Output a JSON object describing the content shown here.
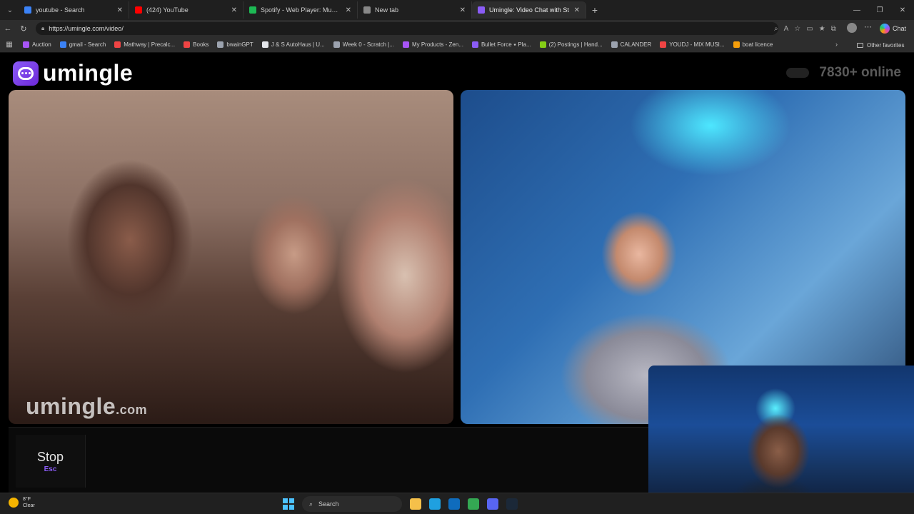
{
  "browser": {
    "tabs": [
      {
        "title": "youtube - Search",
        "favicon_color": "#3b82f6",
        "active": false,
        "width": 155
      },
      {
        "title": "(424) YouTube",
        "favicon_color": "#ff0000",
        "active": false,
        "width": 160
      },
      {
        "title": "Spotify - Web Player: Music for ev",
        "favicon_color": "#1db954",
        "active": false,
        "width": 160
      },
      {
        "title": "New tab",
        "favicon_color": "#888888",
        "active": false,
        "width": 160
      },
      {
        "title": "Umingle: Video Chat with St",
        "favicon_color": "#8b5cf6",
        "active": true,
        "width": 160
      }
    ],
    "new_tab_label": "+",
    "url": "https://umingle.com/video/",
    "copilot_label": "Chat",
    "bookmarks": [
      {
        "label": "Auction",
        "color": "#a855f7"
      },
      {
        "label": "gmail - Search",
        "color": "#3b82f6"
      },
      {
        "label": "Mathway | Precalc...",
        "color": "#ef4444"
      },
      {
        "label": "Books",
        "color": "#ef4444"
      },
      {
        "label": "bwainGPT",
        "color": "#9ca3af"
      },
      {
        "label": "J & S AutoHaus | U...",
        "color": "#e5e7eb"
      },
      {
        "label": "Week 0 - Scratch |...",
        "color": "#9ca3af"
      },
      {
        "label": "My Products - Zen...",
        "color": "#a855f7"
      },
      {
        "label": "Bullet Force ⭑ Pla...",
        "color": "#8b5cf6"
      },
      {
        "label": "(2) Postings | Hand...",
        "color": "#84cc16"
      },
      {
        "label": "CALANDER",
        "color": "#9ca3af"
      },
      {
        "label": "YOUDJ - MIX MUSI...",
        "color": "#ef4444"
      },
      {
        "label": "boat licence",
        "color": "#f59e0b"
      }
    ],
    "other_bookmarks_label": "Other favorites"
  },
  "page": {
    "logo_text": "umingle",
    "online_count": "7830+ online",
    "watermark": "umingle",
    "watermark_suffix": ".com",
    "stop_label": "Stop",
    "stop_key": "Esc",
    "accent": "#8b5cf6"
  },
  "taskbar": {
    "weather_temp": "8°F",
    "weather_desc": "Clear",
    "search_label": "Search",
    "apps": [
      {
        "name": "file-explorer-icon",
        "color": "#f5c04a"
      },
      {
        "name": "edge-icon",
        "color": "#1fa0e0"
      },
      {
        "name": "outlook-icon",
        "color": "#0f6cbd"
      },
      {
        "name": "chrome-icon",
        "color": "#34a853"
      },
      {
        "name": "discord-icon",
        "color": "#5865f2"
      },
      {
        "name": "steam-icon",
        "color": "#1b2838"
      }
    ]
  }
}
